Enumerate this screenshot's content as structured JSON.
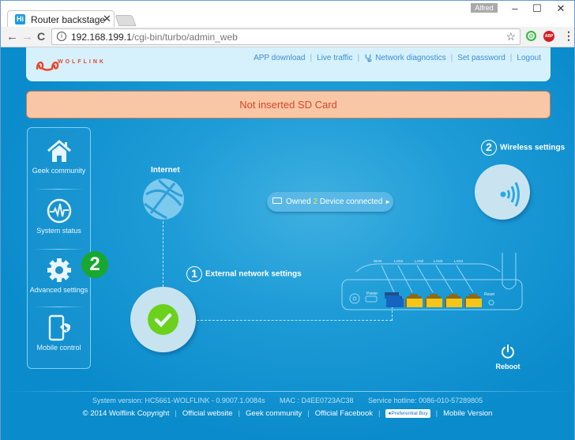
{
  "browser": {
    "tab_title": "Router backstage",
    "tab_favicon": "Hi",
    "user_name": "Alfred",
    "url_host": "192.168.199.1",
    "url_path": "/cgi-bin/turbo/admin_web",
    "icons": [
      "back-icon",
      "forward-icon",
      "reload-icon",
      "info-icon",
      "star-icon",
      "extension-green-icon",
      "adblock-icon",
      "menu-icon"
    ],
    "extension_abp": "ABP"
  },
  "header": {
    "brand": "WOLFLINK",
    "links": {
      "app_download": "APP download",
      "live_traffic": "Live traffic",
      "network_diagnostics": "Network diagnostics",
      "set_password": "Set password",
      "logout": "Logout"
    },
    "separator": "|"
  },
  "alert": {
    "message": "Not inserted SD Card",
    "colors": {
      "background": "#f9c7a6",
      "text": "#d6472a"
    }
  },
  "sidebar": {
    "items": [
      {
        "label": "Geek community",
        "icon": "home-icon"
      },
      {
        "label": "System status",
        "icon": "pulse-icon"
      },
      {
        "label": "Advanced settings",
        "icon": "gear-icon"
      },
      {
        "label": "Mobile control",
        "icon": "mobile-icon"
      }
    ]
  },
  "annotation_badge": "2",
  "diagram": {
    "internet_label": "Internet",
    "external_step_number": "1",
    "external_label": "External network settings",
    "wireless_step_number": "2",
    "wireless_label": "Wireless settings",
    "devices": {
      "prefix": "Owned",
      "count": "2",
      "suffix": "Device connected",
      "arrow": "►"
    },
    "router_ports": {
      "power": "Power",
      "wan": "WAN",
      "lan1": "LAN1",
      "lan2": "LAN2",
      "lan3": "LAN3",
      "lan4": "LAN4",
      "reset": "Reset"
    },
    "reboot_label": "Reboot"
  },
  "footer": {
    "system_version": "System version: HC5661-WOLFLINK - 0.9007.1.0084s",
    "mac": "MAC : D4EE0723AC38",
    "hotline": "Service hotline: 0086-010-57289805",
    "copyright": "© 2014 Wolflink Copyright",
    "official_website": "Official website",
    "geek_community": "Geek community",
    "official_facebook": "Official Facebook",
    "preferential_buy": "●Preferential Buy",
    "mobile_version": "Mobile Version",
    "separator": "|"
  }
}
